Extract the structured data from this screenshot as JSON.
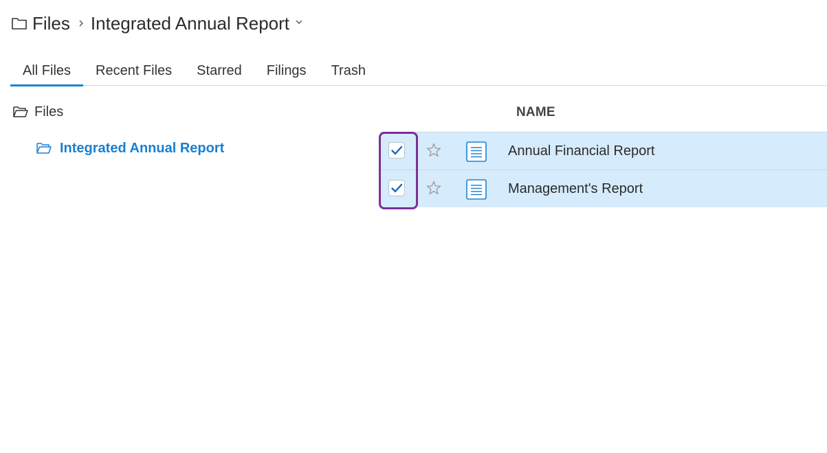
{
  "breadcrumb": {
    "root_label": "Files",
    "current_label": "Integrated Annual Report",
    "icons": [
      "folder-icon",
      "chevron-right-icon",
      "chevron-down-icon"
    ]
  },
  "tabs": [
    {
      "label": "All Files",
      "active": true
    },
    {
      "label": "Recent Files",
      "active": false
    },
    {
      "label": "Starred",
      "active": false
    },
    {
      "label": "Filings",
      "active": false
    },
    {
      "label": "Trash",
      "active": false
    }
  ],
  "tree": {
    "root_label": "Files",
    "child_label": "Integrated Annual Report"
  },
  "table": {
    "name_header": "NAME",
    "rows": [
      {
        "name": "Annual Financial Report",
        "checked": true,
        "starred": false,
        "icon": "document-icon"
      },
      {
        "name": "Management's Report",
        "checked": true,
        "starred": false,
        "icon": "document-icon"
      }
    ]
  },
  "colors": {
    "accent": "#1a84d4",
    "selected_row_bg": "#d6ebfc",
    "highlight_border": "#7b2f98",
    "link_blue": "#1a7fd0"
  }
}
